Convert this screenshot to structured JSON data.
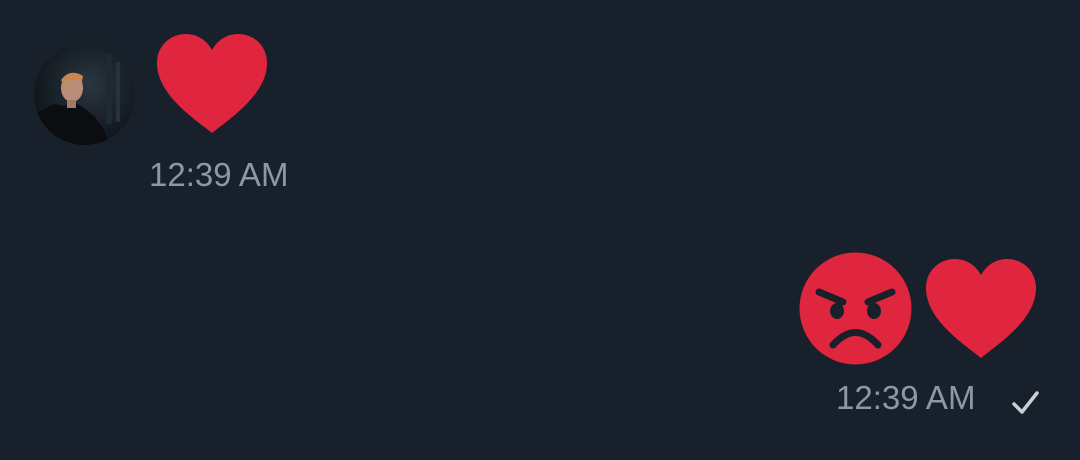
{
  "conversation": {
    "received": {
      "sender_avatar": "avatar-photo",
      "message_emoji": "red-heart-icon",
      "timestamp": "12:39 AM"
    },
    "sent": {
      "message_emojis": [
        "angry-face-icon",
        "red-heart-icon"
      ],
      "timestamp": "12:39 AM",
      "status_icon": "checkmark-icon"
    }
  },
  "colors": {
    "background": "#18202b",
    "emoji_red": "#e0263f",
    "timestamp": "#8b98a5",
    "check": "#c8d0d8"
  }
}
